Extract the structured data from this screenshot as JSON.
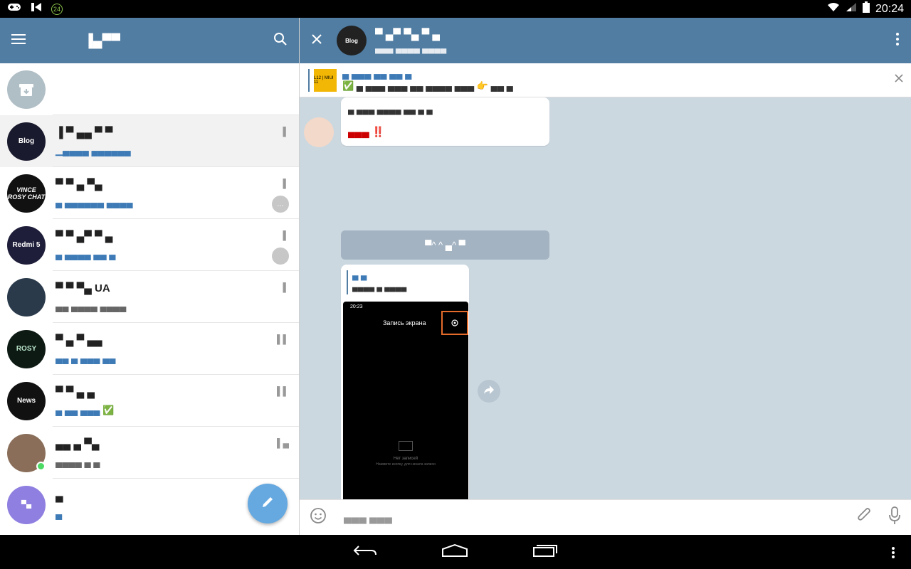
{
  "status_bar": {
    "time": "20:24",
    "badge": "24",
    "left_icons": [
      "gamepad-icon",
      "media-icon",
      "badge-24-icon"
    ],
    "right_icons": [
      "wifi-icon",
      "signal-icon",
      "battery-icon"
    ]
  },
  "left_header": {
    "title": "▐▄▀▀"
  },
  "chats": [
    {
      "kind": "archive",
      "name": "",
      "message": "",
      "time": ""
    },
    {
      "kind": "chat",
      "name": "▐ ▀ ▄▄ ▀ ▀",
      "message": "▁▄▄▄▄ ▄▄▄▄▄▄",
      "time": "▌",
      "avatar_label": "Blog",
      "avatar_color": "#1a1a2e",
      "muted": true
    },
    {
      "kind": "chat",
      "name": "▀ ▀ ▄ ▀▄",
      "message": "▄ ▄▄▄▄▄▄ ▄▄▄▄",
      "time": "▌",
      "avatar_label": "VINCE ROSY CHAT",
      "avatar_color": "#111111",
      "unread": "...",
      "muted": true
    },
    {
      "kind": "chat",
      "name": "▀ ▀ ▄▀ ▀ ▄",
      "message": "▄ ▄▄▄▄ ▄▄ ▄",
      "time": "▌",
      "avatar_label": "Redmi 5",
      "avatar_color": "#1e1e3a",
      "unread": " ",
      "muted": true
    },
    {
      "kind": "chat",
      "name": "▀ ▀ ▀▄  UA",
      "message": "▄▄ ▄▄▄▄ ▄▄▄▄",
      "time": "▌",
      "avatar_label": "",
      "avatar_color": "#2a3a4a"
    },
    {
      "kind": "chat",
      "name": "▀ ▄ ▀ ▄▄",
      "message": "▄▄ ▄ ▄▄▄ ▄▄",
      "time": "▌▌",
      "avatar_label": "ROSY",
      "avatar_color": "#0d1a14",
      "muted": true
    },
    {
      "kind": "chat",
      "name": "▀ ▀ ▄ ▄",
      "message": "▄ ▄▄ ▄▄▄ ✅",
      "time": "▌▌",
      "avatar_label": "News",
      "avatar_color": "#111111"
    },
    {
      "kind": "chat",
      "name": "▄▄ ▄ ▀▄",
      "message": "▄▄▄▄ ▄ ▄",
      "time": "▌▄",
      "avatar_label": "",
      "avatar_color": "#8a6e5a",
      "online": true
    },
    {
      "kind": "chat",
      "name": "▄",
      "message": "▄",
      "time": "",
      "avatar_label": "▀▄",
      "avatar_color": "#8e7fe0"
    }
  ],
  "right_header": {
    "title": "▀ ▄▀ ▀▄ ▀ ▄",
    "subtitle": "▄▄▄ ▄▄▄▄ ▄▄▄▄",
    "avatar_label": "Blog"
  },
  "pinned": {
    "thumb_label": "L12 | MIUI 11",
    "title": "▄ ▄▄▄ ▄▄ ▄▄ ▄",
    "text": "✅ ▄ ▄▄▄ ▄▄▄ ▄▄ ▄▄▄▄ ▄▄▄ 👉 ▄▄ ▄"
  },
  "messages": {
    "first_bubble_text": "▄ ▄▄▄ ▄▄▄▄ ▄▄ ▄ ▄",
    "first_bubble_footer": "▄▄▄ ‼️",
    "service_text": "▀^ ^ ▄^ ▀",
    "reply_title": "▄ ▄",
    "reply_text": "▄▄▄▄ ▄ ▄▄▄▄",
    "phone_time": "20:23",
    "phone_screen_title": "Запись экрана",
    "phone_empty_line1": "Нет записей",
    "phone_empty_line2": "Нажмите кнопку, для начала записи"
  },
  "compose": {
    "placeholder": "▄▄▄ ▄▄▄"
  }
}
